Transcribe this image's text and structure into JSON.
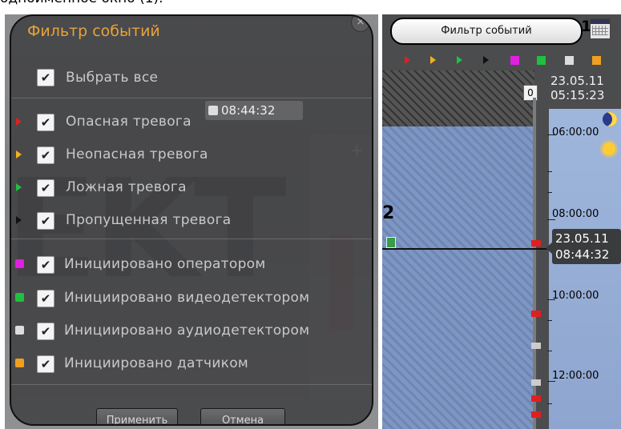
{
  "caption": "одноименное окно (1).",
  "dialog": {
    "title": "Фильтр событий",
    "select_all": "Выбрать все",
    "items": [
      {
        "label": "Опасная тревога",
        "color": "#e02020"
      },
      {
        "label": "Неопасная тревога",
        "color": "#f0b020"
      },
      {
        "label": "Ложная тревога",
        "color": "#20c040"
      },
      {
        "label": "Пропущенная тревога",
        "color": "#111111"
      },
      {
        "label": "Инициировано оператором",
        "color": "#e020e0"
      },
      {
        "label": "Инициировано видеодетектором",
        "color": "#20c040"
      },
      {
        "label": "Инициировано аудиодетектором",
        "color": "#dddddd"
      },
      {
        "label": "Инициировано датчиком",
        "color": "#f0a020"
      }
    ],
    "apply_label": "Применить",
    "cancel_label": "Отмена",
    "overlay_time": "08:44:32"
  },
  "timeline": {
    "filter_button": "Фильтр событий",
    "callout_1": "1",
    "callout_2": "2",
    "zero_label": "0",
    "date_top": "23.05.11",
    "time_top": "05:15:23",
    "times": [
      "06:00:00",
      "08:00:00",
      "10:00:00",
      "12:00:00"
    ],
    "cursor_date": "23.05.11",
    "cursor_time": "08:44:32",
    "icon_colors": [
      "#e02020",
      "#f0b020",
      "#20c040",
      "#111111",
      "#e020e0",
      "#20c040",
      "#dddddd",
      "#f0a020"
    ]
  }
}
